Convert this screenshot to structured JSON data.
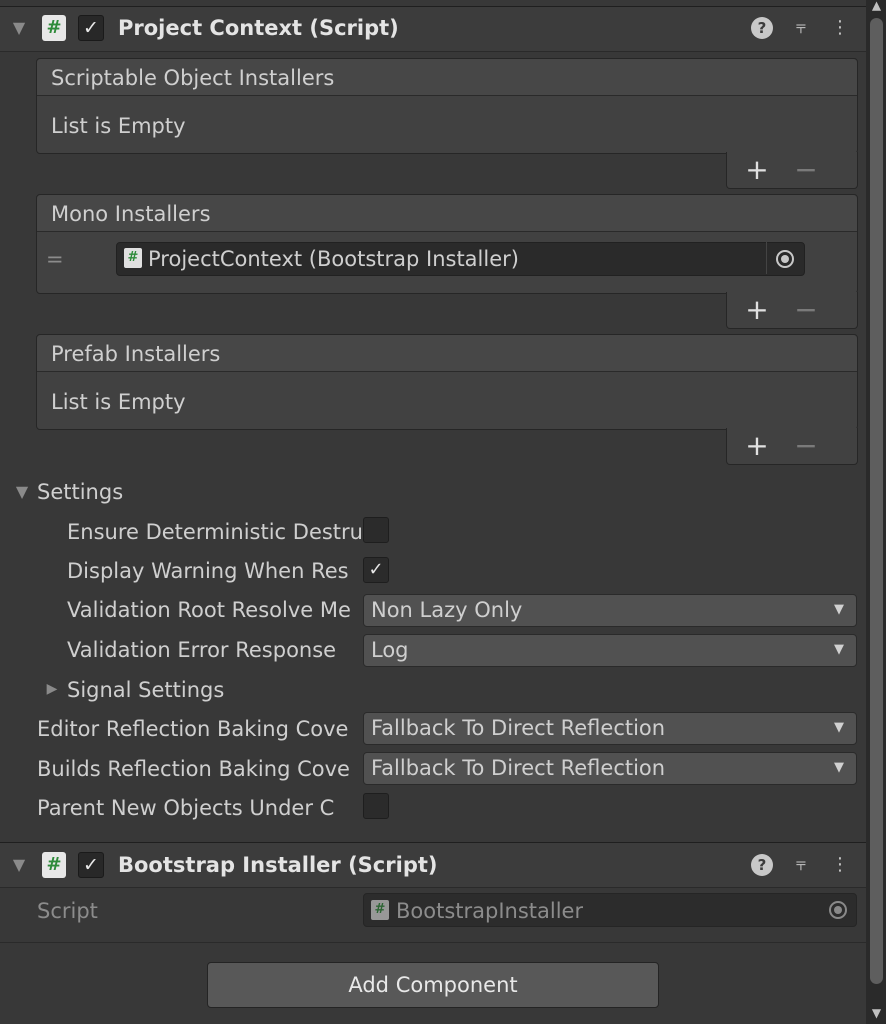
{
  "components": [
    {
      "title": "Project Context (Script)",
      "enabled": true
    },
    {
      "title": "Bootstrap Installer (Script)",
      "enabled": true
    }
  ],
  "lists": {
    "scriptable": {
      "title": "Scriptable Object Installers",
      "empty": "List is Empty"
    },
    "mono": {
      "title": "Mono Installers",
      "item": "ProjectContext (Bootstrap Installer)",
      "handle": "="
    },
    "prefab": {
      "title": "Prefab Installers",
      "empty": "List is Empty"
    }
  },
  "list_buttons": {
    "add": "+",
    "remove": "−"
  },
  "settings": {
    "title": "Settings",
    "ensure_label": "Ensure Deterministic Destru",
    "display_label": "Display Warning When Res",
    "validation_root_label": "Validation Root Resolve Me",
    "validation_root_value": "Non Lazy Only",
    "validation_error_label": "Validation Error Response",
    "validation_error_value": "Log",
    "signal_settings": "Signal Settings"
  },
  "editor_baking_label": "Editor Reflection Baking Cove",
  "editor_baking_value": "Fallback To Direct Reflection",
  "builds_baking_label": "Builds Reflection Baking Cove",
  "builds_baking_value": "Fallback To Direct Reflection",
  "parent_label": "Parent New Objects Under C",
  "bootstrap": {
    "script_label": "Script",
    "script_value": "BootstrapInstaller"
  },
  "add_component": "Add Component",
  "icons": {
    "script": "#",
    "check": "✓",
    "help": "?",
    "presets": "⫧",
    "more": "⋮",
    "foldout_open": "▼",
    "foldout_closed": "▶",
    "dropdown": "▼"
  }
}
